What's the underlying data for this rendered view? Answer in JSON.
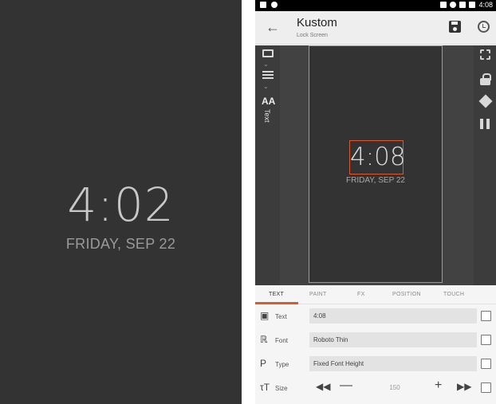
{
  "lock_preview": {
    "time": "4:02",
    "date": "FRIDAY, SEP 22"
  },
  "statusbar": {
    "time": "4:08"
  },
  "appbar": {
    "title": "Kustom",
    "subtitle": "Lock Screen"
  },
  "left_rail": {
    "text_label": "Text",
    "aa_glyph": "AA"
  },
  "canvas": {
    "time": "4:08",
    "date": "FRIDAY, SEP 22"
  },
  "tabs": [
    {
      "label": "TEXT"
    },
    {
      "label": "PAINT"
    },
    {
      "label": "FX"
    },
    {
      "label": "POSITION"
    },
    {
      "label": "TOUCH"
    }
  ],
  "properties": [
    {
      "label": "Text",
      "value": "4:08",
      "icon": "text-field-icon"
    },
    {
      "label": "Font",
      "value": "Roboto Thin",
      "icon": "font-icon"
    },
    {
      "label": "Type",
      "value": "Fixed Font Height",
      "icon": "paragraph-icon"
    },
    {
      "label": "Size",
      "value": "150",
      "icon": "text-size-icon"
    }
  ],
  "colors": {
    "accent": "#e0572b",
    "editor_bg": "#424242",
    "lock_bg": "#333333"
  }
}
